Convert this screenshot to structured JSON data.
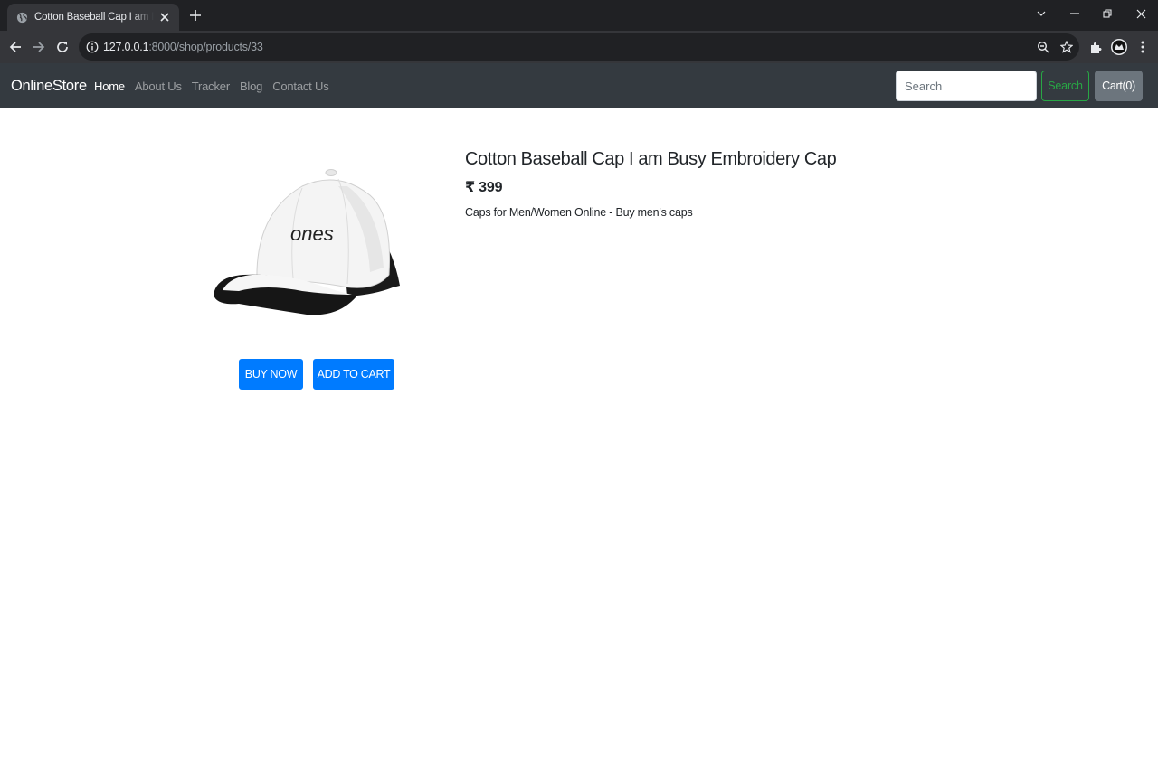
{
  "browser": {
    "tab_title": "Cotton Baseball Cap I am Busy Embroidery Cap",
    "url_host": "127.0.0.1",
    "url_path": ":8000/shop/products/33"
  },
  "navbar": {
    "brand": "OnlineStore",
    "links": [
      {
        "label": "Home",
        "active": true
      },
      {
        "label": "About Us",
        "active": false
      },
      {
        "label": "Tracker",
        "active": false
      },
      {
        "label": "Blog",
        "active": false
      },
      {
        "label": "Contact Us",
        "active": false
      }
    ],
    "search_placeholder": "Search",
    "search_button": "Search",
    "cart_button": "Cart(0)"
  },
  "product": {
    "title": "Cotton Baseball Cap I am Busy Embroidery Cap",
    "price": "₹ 399",
    "description": "Caps for Men/Women Online - Buy men's caps",
    "image_text": "ones",
    "buy_now": "BUY NOW",
    "add_to_cart": "ADD TO CART"
  },
  "colors": {
    "navbar_bg": "#343a40",
    "primary": "#007bff",
    "success": "#28a745",
    "secondary": "#6c757d"
  }
}
